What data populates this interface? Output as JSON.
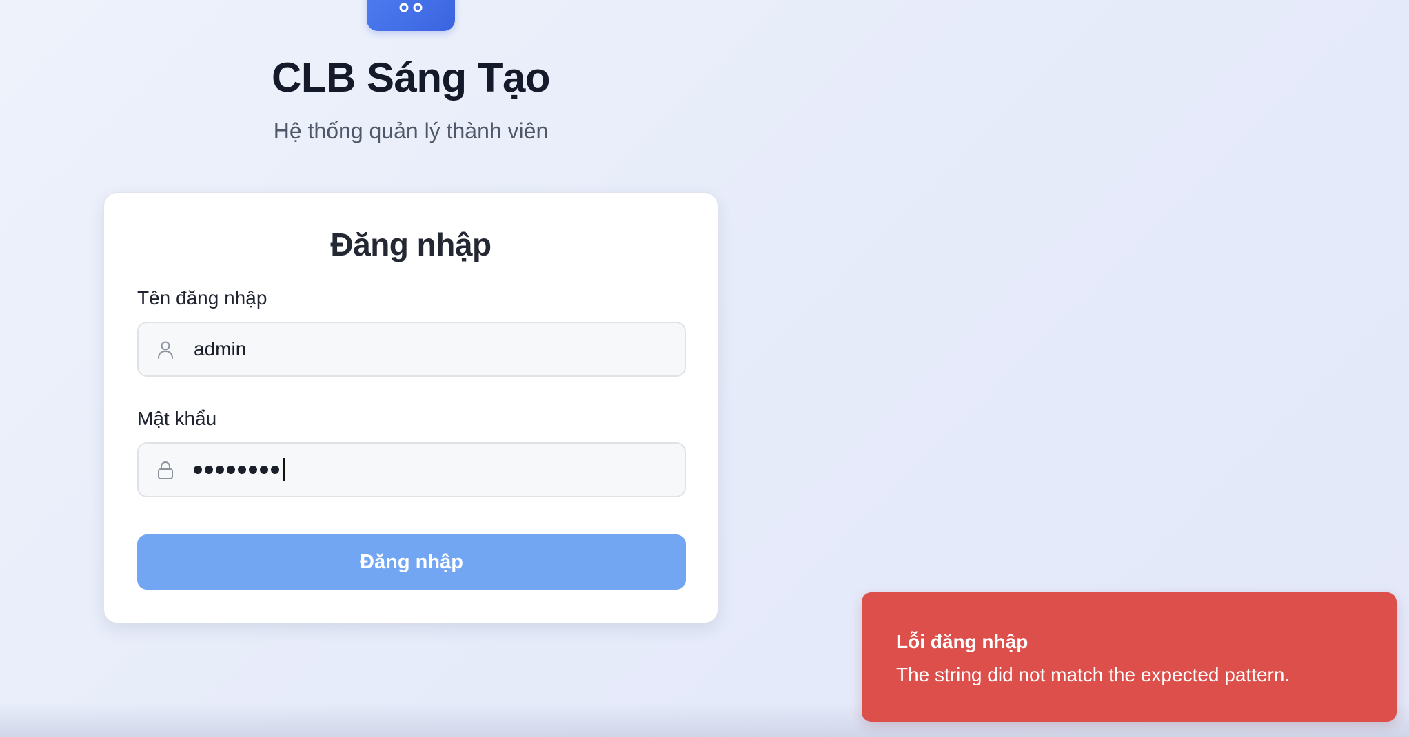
{
  "app": {
    "title": "CLB Sáng Tạo",
    "subtitle": "Hệ thống quản lý thành viên",
    "logo_icon": "users-icon",
    "accent_color": "#3a64e0"
  },
  "login_form": {
    "heading": "Đăng nhập",
    "username": {
      "label": "Tên đăng nhập",
      "value": "admin",
      "icon": "user-icon"
    },
    "password": {
      "label": "Mật khẩu",
      "masked_value": "••••••••",
      "length": 8,
      "icon": "lock-icon"
    },
    "submit_label": "Đăng nhập",
    "submit_color": "#72a6f2"
  },
  "toast": {
    "title": "Lỗi đăng nhập",
    "message": "The string did not match the expected pattern.",
    "color": "#dc4f4a"
  }
}
